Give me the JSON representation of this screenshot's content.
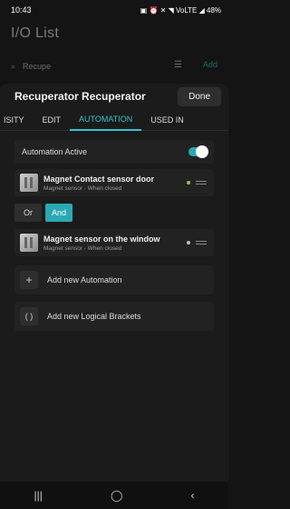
{
  "status": {
    "time": "10:43",
    "icons": "▣ ⏰ ✕ ◥ VoLTE ◢ 48%",
    "battery": "48%"
  },
  "background": {
    "title": "I/O List",
    "search_placeholder": "Recupe",
    "add_label": "Add"
  },
  "sheet": {
    "title": "Recuperator Recuperator",
    "done_label": "Done",
    "tabs": [
      {
        "label": "ISITY",
        "active": false
      },
      {
        "label": "EDIT",
        "active": false
      },
      {
        "label": "AUTOMATION",
        "active": true
      },
      {
        "label": "USED IN",
        "active": false
      }
    ],
    "toggle": {
      "label": "Automation Active",
      "on": true
    },
    "devices": [
      {
        "name": "Magnet Contact sensor door",
        "subtitle": "Magnet sensor - When closed",
        "status_color": "#8fc24a"
      },
      {
        "name": "Magnet sensor on the window",
        "subtitle": "Magnet sensor - When closed",
        "status_color": "#bfbfbf"
      }
    ],
    "logic": {
      "or_label": "Or",
      "and_label": "And",
      "selected": "And"
    },
    "actions": [
      {
        "icon": "+",
        "label": "Add new Automation"
      },
      {
        "icon": "( )",
        "label": "Add new Logical Brackets"
      }
    ]
  },
  "nav": {
    "recent": "|||",
    "home": "◯",
    "back": "‹"
  },
  "colors": {
    "accent": "#2aa9b5",
    "tab_active": "#36c2cf",
    "background": "#141414"
  }
}
